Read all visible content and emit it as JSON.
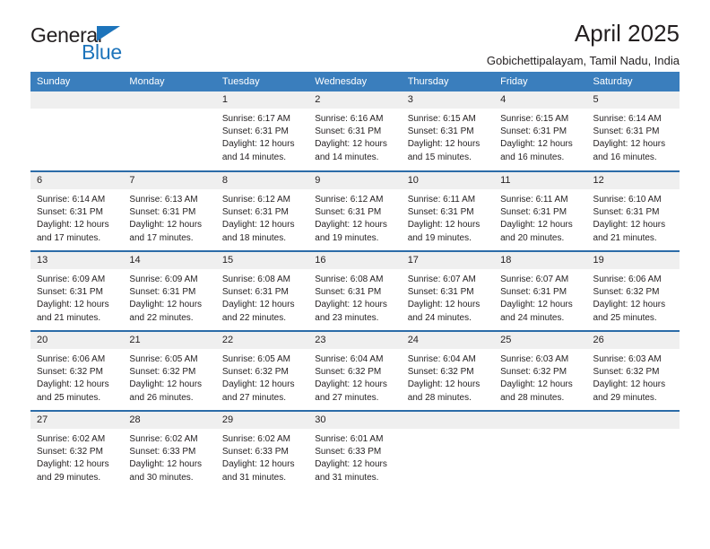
{
  "logo": {
    "text_primary": "General",
    "text_secondary": "Blue",
    "triangle_icon": "triangle-icon",
    "primary_color": "#231f20",
    "accent_color": "#1d74bb"
  },
  "header": {
    "title": "April 2025",
    "subtitle": "Gobichettipalayam, Tamil Nadu, India"
  },
  "theme": {
    "header_bg": "#3a7ebd",
    "header_text": "#ffffff",
    "row_divider": "#2c6ca8",
    "daynum_bg": "#efefef",
    "text": "#231f20"
  },
  "calendar": {
    "weekday_headers": [
      "Sunday",
      "Monday",
      "Tuesday",
      "Wednesday",
      "Thursday",
      "Friday",
      "Saturday"
    ],
    "labels": {
      "sunrise": "Sunrise:",
      "sunset": "Sunset:",
      "daylight": "Daylight:"
    },
    "weeks": [
      [
        {
          "day": "",
          "sunrise": "",
          "sunset": "",
          "daylight_line1": "",
          "daylight_line2": ""
        },
        {
          "day": "",
          "sunrise": "",
          "sunset": "",
          "daylight_line1": "",
          "daylight_line2": ""
        },
        {
          "day": "1",
          "sunrise": "Sunrise: 6:17 AM",
          "sunset": "Sunset: 6:31 PM",
          "daylight_line1": "Daylight: 12 hours",
          "daylight_line2": "and 14 minutes."
        },
        {
          "day": "2",
          "sunrise": "Sunrise: 6:16 AM",
          "sunset": "Sunset: 6:31 PM",
          "daylight_line1": "Daylight: 12 hours",
          "daylight_line2": "and 14 minutes."
        },
        {
          "day": "3",
          "sunrise": "Sunrise: 6:15 AM",
          "sunset": "Sunset: 6:31 PM",
          "daylight_line1": "Daylight: 12 hours",
          "daylight_line2": "and 15 minutes."
        },
        {
          "day": "4",
          "sunrise": "Sunrise: 6:15 AM",
          "sunset": "Sunset: 6:31 PM",
          "daylight_line1": "Daylight: 12 hours",
          "daylight_line2": "and 16 minutes."
        },
        {
          "day": "5",
          "sunrise": "Sunrise: 6:14 AM",
          "sunset": "Sunset: 6:31 PM",
          "daylight_line1": "Daylight: 12 hours",
          "daylight_line2": "and 16 minutes."
        }
      ],
      [
        {
          "day": "6",
          "sunrise": "Sunrise: 6:14 AM",
          "sunset": "Sunset: 6:31 PM",
          "daylight_line1": "Daylight: 12 hours",
          "daylight_line2": "and 17 minutes."
        },
        {
          "day": "7",
          "sunrise": "Sunrise: 6:13 AM",
          "sunset": "Sunset: 6:31 PM",
          "daylight_line1": "Daylight: 12 hours",
          "daylight_line2": "and 17 minutes."
        },
        {
          "day": "8",
          "sunrise": "Sunrise: 6:12 AM",
          "sunset": "Sunset: 6:31 PM",
          "daylight_line1": "Daylight: 12 hours",
          "daylight_line2": "and 18 minutes."
        },
        {
          "day": "9",
          "sunrise": "Sunrise: 6:12 AM",
          "sunset": "Sunset: 6:31 PM",
          "daylight_line1": "Daylight: 12 hours",
          "daylight_line2": "and 19 minutes."
        },
        {
          "day": "10",
          "sunrise": "Sunrise: 6:11 AM",
          "sunset": "Sunset: 6:31 PM",
          "daylight_line1": "Daylight: 12 hours",
          "daylight_line2": "and 19 minutes."
        },
        {
          "day": "11",
          "sunrise": "Sunrise: 6:11 AM",
          "sunset": "Sunset: 6:31 PM",
          "daylight_line1": "Daylight: 12 hours",
          "daylight_line2": "and 20 minutes."
        },
        {
          "day": "12",
          "sunrise": "Sunrise: 6:10 AM",
          "sunset": "Sunset: 6:31 PM",
          "daylight_line1": "Daylight: 12 hours",
          "daylight_line2": "and 21 minutes."
        }
      ],
      [
        {
          "day": "13",
          "sunrise": "Sunrise: 6:09 AM",
          "sunset": "Sunset: 6:31 PM",
          "daylight_line1": "Daylight: 12 hours",
          "daylight_line2": "and 21 minutes."
        },
        {
          "day": "14",
          "sunrise": "Sunrise: 6:09 AM",
          "sunset": "Sunset: 6:31 PM",
          "daylight_line1": "Daylight: 12 hours",
          "daylight_line2": "and 22 minutes."
        },
        {
          "day": "15",
          "sunrise": "Sunrise: 6:08 AM",
          "sunset": "Sunset: 6:31 PM",
          "daylight_line1": "Daylight: 12 hours",
          "daylight_line2": "and 22 minutes."
        },
        {
          "day": "16",
          "sunrise": "Sunrise: 6:08 AM",
          "sunset": "Sunset: 6:31 PM",
          "daylight_line1": "Daylight: 12 hours",
          "daylight_line2": "and 23 minutes."
        },
        {
          "day": "17",
          "sunrise": "Sunrise: 6:07 AM",
          "sunset": "Sunset: 6:31 PM",
          "daylight_line1": "Daylight: 12 hours",
          "daylight_line2": "and 24 minutes."
        },
        {
          "day": "18",
          "sunrise": "Sunrise: 6:07 AM",
          "sunset": "Sunset: 6:31 PM",
          "daylight_line1": "Daylight: 12 hours",
          "daylight_line2": "and 24 minutes."
        },
        {
          "day": "19",
          "sunrise": "Sunrise: 6:06 AM",
          "sunset": "Sunset: 6:32 PM",
          "daylight_line1": "Daylight: 12 hours",
          "daylight_line2": "and 25 minutes."
        }
      ],
      [
        {
          "day": "20",
          "sunrise": "Sunrise: 6:06 AM",
          "sunset": "Sunset: 6:32 PM",
          "daylight_line1": "Daylight: 12 hours",
          "daylight_line2": "and 25 minutes."
        },
        {
          "day": "21",
          "sunrise": "Sunrise: 6:05 AM",
          "sunset": "Sunset: 6:32 PM",
          "daylight_line1": "Daylight: 12 hours",
          "daylight_line2": "and 26 minutes."
        },
        {
          "day": "22",
          "sunrise": "Sunrise: 6:05 AM",
          "sunset": "Sunset: 6:32 PM",
          "daylight_line1": "Daylight: 12 hours",
          "daylight_line2": "and 27 minutes."
        },
        {
          "day": "23",
          "sunrise": "Sunrise: 6:04 AM",
          "sunset": "Sunset: 6:32 PM",
          "daylight_line1": "Daylight: 12 hours",
          "daylight_line2": "and 27 minutes."
        },
        {
          "day": "24",
          "sunrise": "Sunrise: 6:04 AM",
          "sunset": "Sunset: 6:32 PM",
          "daylight_line1": "Daylight: 12 hours",
          "daylight_line2": "and 28 minutes."
        },
        {
          "day": "25",
          "sunrise": "Sunrise: 6:03 AM",
          "sunset": "Sunset: 6:32 PM",
          "daylight_line1": "Daylight: 12 hours",
          "daylight_line2": "and 28 minutes."
        },
        {
          "day": "26",
          "sunrise": "Sunrise: 6:03 AM",
          "sunset": "Sunset: 6:32 PM",
          "daylight_line1": "Daylight: 12 hours",
          "daylight_line2": "and 29 minutes."
        }
      ],
      [
        {
          "day": "27",
          "sunrise": "Sunrise: 6:02 AM",
          "sunset": "Sunset: 6:32 PM",
          "daylight_line1": "Daylight: 12 hours",
          "daylight_line2": "and 29 minutes."
        },
        {
          "day": "28",
          "sunrise": "Sunrise: 6:02 AM",
          "sunset": "Sunset: 6:33 PM",
          "daylight_line1": "Daylight: 12 hours",
          "daylight_line2": "and 30 minutes."
        },
        {
          "day": "29",
          "sunrise": "Sunrise: 6:02 AM",
          "sunset": "Sunset: 6:33 PM",
          "daylight_line1": "Daylight: 12 hours",
          "daylight_line2": "and 31 minutes."
        },
        {
          "day": "30",
          "sunrise": "Sunrise: 6:01 AM",
          "sunset": "Sunset: 6:33 PM",
          "daylight_line1": "Daylight: 12 hours",
          "daylight_line2": "and 31 minutes."
        },
        {
          "day": "",
          "sunrise": "",
          "sunset": "",
          "daylight_line1": "",
          "daylight_line2": ""
        },
        {
          "day": "",
          "sunrise": "",
          "sunset": "",
          "daylight_line1": "",
          "daylight_line2": ""
        },
        {
          "day": "",
          "sunrise": "",
          "sunset": "",
          "daylight_line1": "",
          "daylight_line2": ""
        }
      ]
    ]
  }
}
